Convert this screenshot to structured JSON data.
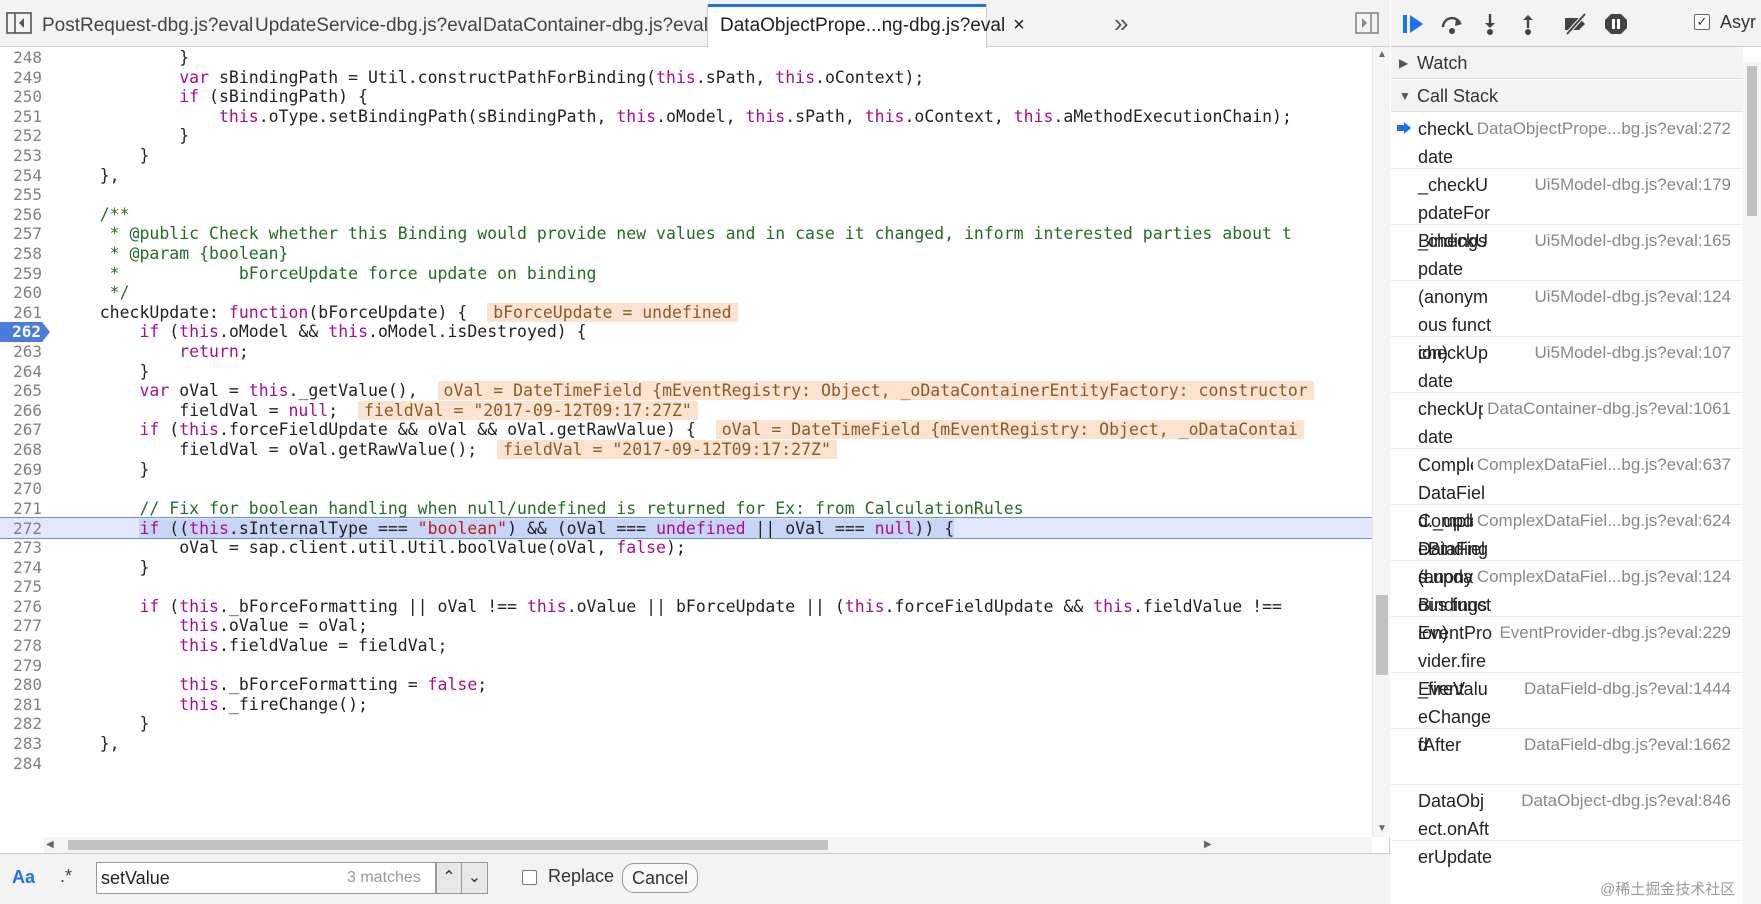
{
  "tabs": [
    {
      "label": "PostRequest-dbg.js?eval"
    },
    {
      "label": "UpdateService-dbg.js?eval"
    },
    {
      "label": "DataContainer-dbg.js?eval"
    },
    {
      "label": "DataObjectPrope...ng-dbg.js?eval",
      "active": true,
      "close": "×"
    }
  ],
  "tabs_overflow": "»",
  "icons": {
    "nav_toggle": "navigator-toggle-icon",
    "debugger_toggle": "debugger-sidebar-toggle-icon",
    "resume": "resume-icon",
    "step_over": "step-over-icon",
    "step_into": "step-into-icon",
    "step_out": "step-out-icon",
    "deactivate_breakpoints": "deactivate-breakpoints-icon",
    "pause_exceptions": "pause-on-exceptions-icon"
  },
  "colors": {
    "accent": "#1a73e8",
    "keyword": "#aa0d91",
    "comment": "#236e25",
    "string": "#c41a16",
    "inline_value_bg": "#fbe3cf",
    "current_line_bg": "#e1e8fb",
    "breakpoint": "#4a7ddb"
  },
  "code": {
    "lines": [
      {
        "n": "248",
        "html": "            }"
      },
      {
        "n": "249",
        "html": "            <span class=\"kw\">var</span> sBindingPath = Util.constructPathForBinding(<span class=\"kw\">this</span>.sPath, <span class=\"kw\">this</span>.oContext);"
      },
      {
        "n": "250",
        "html": "            <span class=\"kw\">if</span> (sBindingPath) {"
      },
      {
        "n": "251",
        "html": "                <span class=\"kw\">this</span>.oType.setBindingPath(sBindingPath, <span class=\"kw\">this</span>.oModel, <span class=\"kw\">this</span>.sPath, <span class=\"kw\">this</span>.oContext, <span class=\"kw\">this</span>.aMethodExecutionChain);"
      },
      {
        "n": "252",
        "html": "            }"
      },
      {
        "n": "253",
        "html": "        }"
      },
      {
        "n": "254",
        "html": "    },"
      },
      {
        "n": "255",
        "html": ""
      },
      {
        "n": "256",
        "html": "    <span class=\"cm\">/**</span>"
      },
      {
        "n": "257",
        "html": "    <span class=\"cm\"> * @public Check whether this Binding would provide new values and in case it changed, inform interested parties about t</span>"
      },
      {
        "n": "258",
        "html": "    <span class=\"cm\"> * @param {boolean}</span>"
      },
      {
        "n": "259",
        "html": "    <span class=\"cm\"> *            bForceUpdate force update on binding</span>"
      },
      {
        "n": "260",
        "html": "    <span class=\"cm\"> */</span>"
      },
      {
        "n": "261",
        "html": "    checkUpdate: <span class=\"kw\">function</span>(bForceUpdate) {  <span class=\"inline-val\">bForceUpdate = undefined</span>"
      },
      {
        "n": "262",
        "html": "        <span class=\"kw\">if</span> (<span class=\"kw\">this</span>.oModel &amp;&amp; <span class=\"kw\">this</span>.oModel.isDestroyed) {",
        "breakpoint": true
      },
      {
        "n": "263",
        "html": "            <span class=\"kw\">return</span>;"
      },
      {
        "n": "264",
        "html": "        }"
      },
      {
        "n": "265",
        "html": "        <span class=\"kw\">var</span> oVal = <span class=\"kw\">this</span>._getValue(),  <span class=\"inline-val\">oVal = DateTimeField {mEventRegistry: Object, _oDataContainerEntityFactory: constructor</span>"
      },
      {
        "n": "266",
        "html": "            fieldVal = <span class=\"kw\">null</span>;  <span class=\"inline-val\">fieldVal = \"2017-09-12T09:17:27Z\"</span>"
      },
      {
        "n": "267",
        "html": "        <span class=\"kw\">if</span> (<span class=\"kw\">this</span>.forceFieldUpdate &amp;&amp; oVal &amp;&amp; oVal.getRawValue) {  <span class=\"inline-val\">oVal = DateTimeField {mEventRegistry: Object, _oDataContai</span>"
      },
      {
        "n": "268",
        "html": "            fieldVal = oVal.getRawValue();  <span class=\"inline-val\">fieldVal = \"2017-09-12T09:17:27Z\"</span>"
      },
      {
        "n": "269",
        "html": "        }"
      },
      {
        "n": "270",
        "html": ""
      },
      {
        "n": "271",
        "html": "        <span class=\"cm\">// Fix for boolean handling when null/undefined is returned for Ex: from CalculationRules</span>"
      },
      {
        "n": "272",
        "html": "        <span class=\"sel\"><span class=\"kw\">if</span> ((<span class=\"kw\">this</span>.sInternalType === <span class=\"str\">\"boolean\"</span>) &amp;&amp; (oVal === <span class=\"kw\">undefined</span> || oVal === <span class=\"kw\">null</span>)) {</span>",
        "current": true
      },
      {
        "n": "273",
        "html": "            oVal = sap.client.util.Util.boolValue(oVal, <span class=\"kw\">false</span>);"
      },
      {
        "n": "274",
        "html": "        }"
      },
      {
        "n": "275",
        "html": ""
      },
      {
        "n": "276",
        "html": "        <span class=\"kw\">if</span> (<span class=\"kw\">this</span>._bForceFormatting || oVal !== <span class=\"kw\">this</span>.oValue || bForceUpdate || (<span class=\"kw\">this</span>.forceFieldUpdate &amp;&amp; <span class=\"kw\">this</span>.fieldValue !=="
      },
      {
        "n": "277",
        "html": "            <span class=\"kw\">this</span>.oValue = oVal;"
      },
      {
        "n": "278",
        "html": "            <span class=\"kw\">this</span>.fieldValue = fieldVal;"
      },
      {
        "n": "279",
        "html": ""
      },
      {
        "n": "280",
        "html": "            <span class=\"kw\">this</span>._bForceFormatting = <span class=\"kw\">false</span>;"
      },
      {
        "n": "281",
        "html": "            <span class=\"kw\">this</span>._fireChange();"
      },
      {
        "n": "282",
        "html": "        }"
      },
      {
        "n": "283",
        "html": "    },"
      },
      {
        "n": "284",
        "html": ""
      }
    ]
  },
  "search": {
    "case_label": "Aa",
    "regex_label": ".*",
    "value": "setValue",
    "match_count": "3 matches",
    "prev": "⌃",
    "next": "⌄",
    "replace_label": "Replace",
    "cancel_label": "Cancel"
  },
  "debugger": {
    "async_label": "Asyr",
    "async_checked": "✓",
    "watch_label": "Watch",
    "callstack_label": "Call Stack",
    "frames": [
      {
        "fn": "checkUpdate",
        "loc": "DataObjectPrope...bg.js?eval:272",
        "current": true
      },
      {
        "fn": "_checkUpdateForBindings",
        "loc": "Ui5Model-dbg.js?eval:179"
      },
      {
        "fn": "_checkUpdate",
        "loc": "Ui5Model-dbg.js?eval:165"
      },
      {
        "fn": "(anonymous function)",
        "loc": "Ui5Model-dbg.js?eval:124"
      },
      {
        "fn": "checkUpdate",
        "loc": "Ui5Model-dbg.js?eval:107"
      },
      {
        "fn": "checkUpdate",
        "loc": "DataContainer-dbg.js?eval:1061"
      },
      {
        "fn": "ComplexDataField._updateBindings",
        "loc": "ComplexDataFiel...bg.js?eval:637"
      },
      {
        "fn": "ComplexDataField.updateBindings",
        "loc": "ComplexDataFiel...bg.js?eval:624"
      },
      {
        "fn": "(anonymous function)",
        "loc": "ComplexDataFiel...bg.js?eval:124"
      },
      {
        "fn": "EventProvider.fireEvent",
        "loc": "EventProvider-dbg.js?eval:229"
      },
      {
        "fn": "_fireValueChanged",
        "loc": "DataField-dbg.js?eval:1444"
      },
      {
        "fn": "fAfter",
        "loc": "DataField-dbg.js?eval:1662"
      },
      {
        "fn": "DataObject.onAfterUpdate",
        "loc": "DataObject-dbg.js?eval:846"
      }
    ]
  },
  "watermark": "@稀土掘金技术社区"
}
